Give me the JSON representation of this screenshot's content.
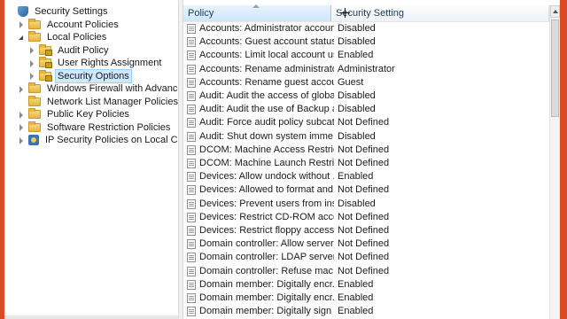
{
  "tree": [
    {
      "label": "Security Settings",
      "indent": 0,
      "toggle": "none",
      "icon": "shield-icon",
      "selected": false
    },
    {
      "label": "Account Policies",
      "indent": 1,
      "toggle": "closed",
      "icon": "folder-icon",
      "selected": false
    },
    {
      "label": "Local Policies",
      "indent": 1,
      "toggle": "open",
      "icon": "folder-icon",
      "selected": false
    },
    {
      "label": "Audit Policy",
      "indent": 2,
      "toggle": "closed",
      "icon": "folder-lock-icon",
      "selected": false
    },
    {
      "label": "User Rights Assignment",
      "indent": 2,
      "toggle": "closed",
      "icon": "folder-lock-icon",
      "selected": false
    },
    {
      "label": "Security Options",
      "indent": 2,
      "toggle": "closed",
      "icon": "folder-lock-icon",
      "selected": true
    },
    {
      "label": "Windows Firewall with Advanced Secu",
      "indent": 1,
      "toggle": "closed",
      "icon": "folder-icon",
      "selected": false
    },
    {
      "label": "Network List Manager Policies",
      "indent": 1,
      "toggle": "none",
      "icon": "folder-icon",
      "selected": false
    },
    {
      "label": "Public Key Policies",
      "indent": 1,
      "toggle": "closed",
      "icon": "folder-icon",
      "selected": false
    },
    {
      "label": "Software Restriction Policies",
      "indent": 1,
      "toggle": "closed",
      "icon": "folder-icon",
      "selected": false
    },
    {
      "label": "IP Security Policies on Local Compute",
      "indent": 1,
      "toggle": "closed",
      "icon": "ipsec-icon",
      "selected": false
    }
  ],
  "list": {
    "columns": {
      "policy": "Policy",
      "setting": "Security Setting"
    },
    "rows": [
      {
        "policy": "Accounts: Administrator account...",
        "setting": "Disabled"
      },
      {
        "policy": "Accounts: Guest account status",
        "setting": "Disabled"
      },
      {
        "policy": "Accounts: Limit local account us...",
        "setting": "Enabled"
      },
      {
        "policy": "Accounts: Rename administrator ...",
        "setting": "Administrator"
      },
      {
        "policy": "Accounts: Rename guest account",
        "setting": "Guest"
      },
      {
        "policy": "Audit: Audit the access of global ...",
        "setting": "Disabled"
      },
      {
        "policy": "Audit: Audit the use of Backup a...",
        "setting": "Disabled"
      },
      {
        "policy": "Audit: Force audit policy subcate...",
        "setting": "Not Defined"
      },
      {
        "policy": "Audit: Shut down system imme...",
        "setting": "Disabled"
      },
      {
        "policy": "DCOM: Machine Access Restrict...",
        "setting": "Not Defined"
      },
      {
        "policy": "DCOM: Machine Launch Restric...",
        "setting": "Not Defined"
      },
      {
        "policy": "Devices: Allow undock without ...",
        "setting": "Enabled"
      },
      {
        "policy": "Devices: Allowed to format and ...",
        "setting": "Not Defined"
      },
      {
        "policy": "Devices: Prevent users from inst...",
        "setting": "Disabled"
      },
      {
        "policy": "Devices: Restrict CD-ROM acces...",
        "setting": "Not Defined"
      },
      {
        "policy": "Devices: Restrict floppy access t...",
        "setting": "Not Defined"
      },
      {
        "policy": "Domain controller: Allow server ...",
        "setting": "Not Defined"
      },
      {
        "policy": "Domain controller: LDAP server ...",
        "setting": "Not Defined"
      },
      {
        "policy": "Domain controller: Refuse mac...",
        "setting": "Not Defined"
      },
      {
        "policy": "Domain member: Digitally encr...",
        "setting": "Enabled"
      },
      {
        "policy": "Domain member: Digitally encr...",
        "setting": "Enabled"
      },
      {
        "policy": "Domain member: Digitally sign ...",
        "setting": "Enabled"
      }
    ]
  },
  "colors": {
    "desktop": "#d9411f",
    "selection": "#cde8ff",
    "header_active": "#cfe6fb"
  }
}
